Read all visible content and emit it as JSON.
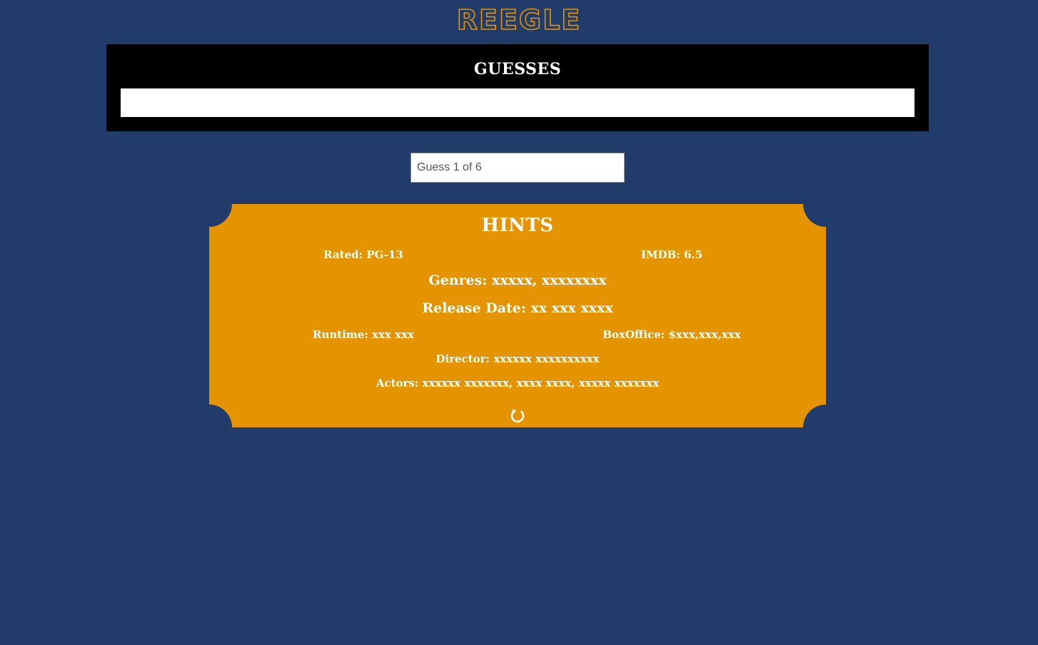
{
  "app": {
    "logo_text": "REEGLE"
  },
  "guesses": {
    "title": "GUESSES",
    "items": []
  },
  "guess_input": {
    "placeholder": "Guess 1 of 6",
    "value": ""
  },
  "hints": {
    "title": "HINTS",
    "rated": "Rated: PG-13",
    "imdb": "IMDB: 6.5",
    "genres": "Genres: xxxxx, xxxxxxxx",
    "release_date": "Release Date: xx xxx xxxx",
    "runtime": "Runtime: xxx xxx",
    "box_office": "BoxOffice: $xxx,xxx,xxx",
    "director": "Director: xxxxxx xxxxxxxxxx",
    "actors": "Actors: xxxxxx xxxxxxx, xxxx xxxx, xxxxx xxxxxxx",
    "reload_icon": "reload-icon"
  },
  "colors": {
    "background": "#213c6b",
    "accent": "#e39400",
    "panel": "#000000",
    "text_light": "#ffffff"
  }
}
